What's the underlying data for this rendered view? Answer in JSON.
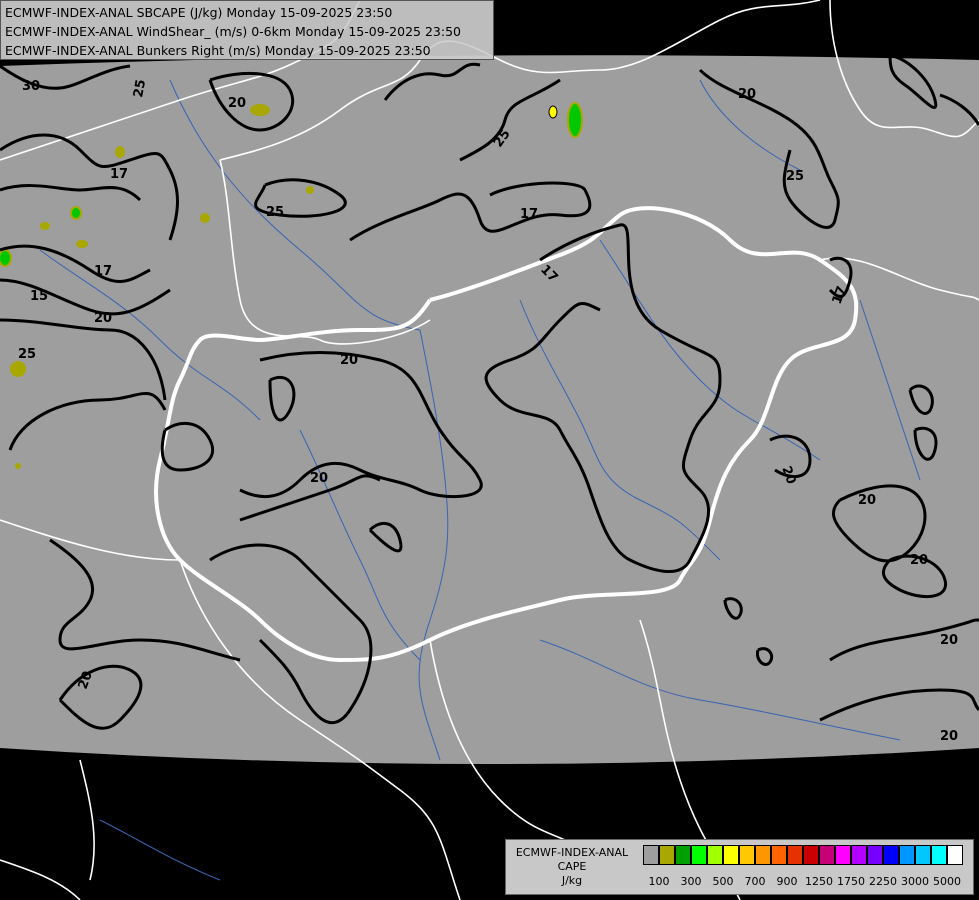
{
  "header": {
    "lines": [
      "ECMWF-INDEX-ANAL SBCAPE (J/kg) Monday 15-09-2025 23:50",
      "ECMWF-INDEX-ANAL WindShear_ (m/s) 0-6km Monday 15-09-2025 23:50",
      "ECMWF-INDEX-ANAL Bunkers Right (m/s) Monday 15-09-2025 23:50"
    ]
  },
  "legend": {
    "title_line1": "ECMWF-INDEX-ANAL",
    "title_line2": "CAPE",
    "title_line3": "J/kg",
    "colors": [
      "#9e9e9e",
      "#a8a800",
      "#00a000",
      "#00ff00",
      "#a0ff00",
      "#ffff00",
      "#ffc800",
      "#ff9600",
      "#ff6400",
      "#e63200",
      "#c80000",
      "#c80078",
      "#ff00ff",
      "#b400ff",
      "#7800ff",
      "#0000ff",
      "#0096ff",
      "#00c8ff",
      "#00ffff",
      "#ffffff"
    ],
    "tick_labels": [
      "100",
      "300",
      "500",
      "700",
      "900",
      "1250",
      "1750",
      "2250",
      "3000",
      "5000"
    ]
  },
  "map": {
    "background_color": "#000000",
    "field_color": "#9e9e9e",
    "contour_labels": [
      {
        "text": "30"
      },
      {
        "text": "25"
      },
      {
        "text": "20"
      },
      {
        "text": "25"
      },
      {
        "text": "20"
      },
      {
        "text": "17"
      },
      {
        "text": "25"
      },
      {
        "text": "17"
      },
      {
        "text": "17"
      },
      {
        "text": "15"
      },
      {
        "text": "20"
      },
      {
        "text": "25"
      },
      {
        "text": "17"
      },
      {
        "text": "20"
      },
      {
        "text": "20"
      },
      {
        "text": "20"
      },
      {
        "text": "20"
      },
      {
        "text": "20"
      },
      {
        "text": "20"
      },
      {
        "text": "20"
      },
      {
        "text": "20"
      },
      {
        "text": "17"
      },
      {
        "text": "25"
      }
    ]
  }
}
